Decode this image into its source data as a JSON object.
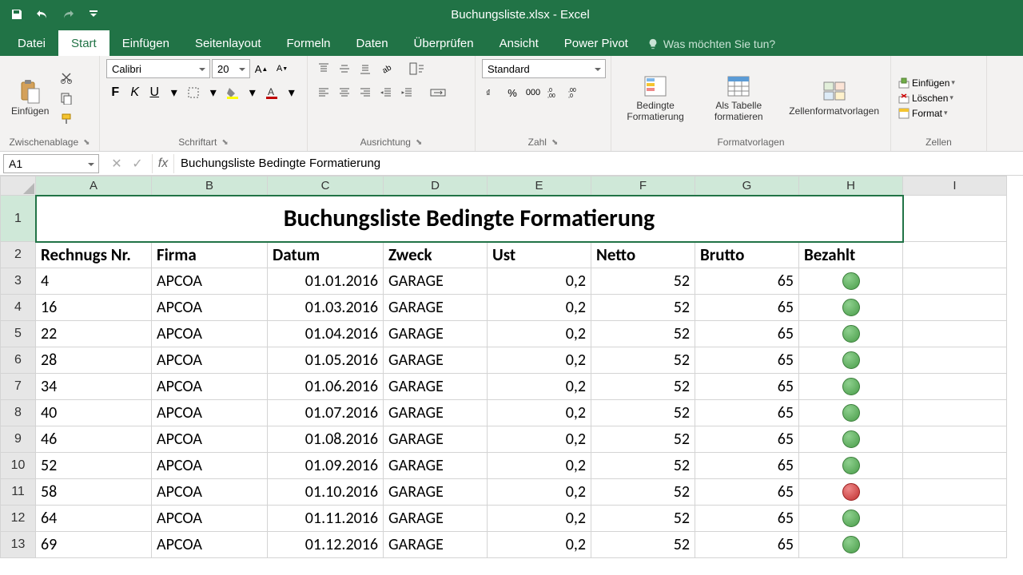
{
  "app": {
    "title": "Buchungsliste.xlsx - Excel"
  },
  "tabs": {
    "file": "Datei",
    "home": "Start",
    "insert": "Einfügen",
    "pagelayout": "Seitenlayout",
    "formulas": "Formeln",
    "data": "Daten",
    "review": "Überprüfen",
    "view": "Ansicht",
    "powerpivot": "Power Pivot",
    "tellme": "Was möchten Sie tun?"
  },
  "ribbon": {
    "clipboard": {
      "label": "Zwischenablage",
      "paste": "Einfügen"
    },
    "font": {
      "label": "Schriftart",
      "name": "Calibri",
      "size": "20",
      "bold": "F",
      "italic": "K",
      "underline": "U"
    },
    "alignment": {
      "label": "Ausrichtung"
    },
    "number": {
      "label": "Zahl",
      "format": "Standard"
    },
    "styles": {
      "label": "Formatvorlagen",
      "cond": "Bedingte Formatierung",
      "table": "Als Tabelle formatieren",
      "cellstyles": "Zellenformatvorlagen"
    },
    "cells": {
      "label": "Zellen",
      "insert": "Einfügen",
      "delete": "Löschen",
      "format": "Format"
    }
  },
  "formula_bar": {
    "name_box": "A1",
    "formula": "Buchungsliste Bedingte Formatierung"
  },
  "columns": [
    "A",
    "B",
    "C",
    "D",
    "E",
    "F",
    "G",
    "H",
    "I"
  ],
  "sheet": {
    "title": "Buchungsliste Bedingte Formatierung",
    "headers": {
      "a": "Rechnugs Nr.",
      "b": "Firma",
      "c": "Datum",
      "d": "Zweck",
      "e": "Ust",
      "f": "Netto",
      "g": "Brutto",
      "h": "Bezahlt"
    },
    "rows": [
      {
        "n": "4",
        "firma": "APCOA",
        "datum": "01.01.2016",
        "zweck": "GARAGE",
        "ust": "0,2",
        "netto": "52",
        "brutto": "65",
        "paid": "green"
      },
      {
        "n": "16",
        "firma": "APCOA",
        "datum": "01.03.2016",
        "zweck": "GARAGE",
        "ust": "0,2",
        "netto": "52",
        "brutto": "65",
        "paid": "green"
      },
      {
        "n": "22",
        "firma": "APCOA",
        "datum": "01.04.2016",
        "zweck": "GARAGE",
        "ust": "0,2",
        "netto": "52",
        "brutto": "65",
        "paid": "green"
      },
      {
        "n": "28",
        "firma": "APCOA",
        "datum": "01.05.2016",
        "zweck": "GARAGE",
        "ust": "0,2",
        "netto": "52",
        "brutto": "65",
        "paid": "green"
      },
      {
        "n": "34",
        "firma": "APCOA",
        "datum": "01.06.2016",
        "zweck": "GARAGE",
        "ust": "0,2",
        "netto": "52",
        "brutto": "65",
        "paid": "green"
      },
      {
        "n": "40",
        "firma": "APCOA",
        "datum": "01.07.2016",
        "zweck": "GARAGE",
        "ust": "0,2",
        "netto": "52",
        "brutto": "65",
        "paid": "green"
      },
      {
        "n": "46",
        "firma": "APCOA",
        "datum": "01.08.2016",
        "zweck": "GARAGE",
        "ust": "0,2",
        "netto": "52",
        "brutto": "65",
        "paid": "green"
      },
      {
        "n": "52",
        "firma": "APCOA",
        "datum": "01.09.2016",
        "zweck": "GARAGE",
        "ust": "0,2",
        "netto": "52",
        "brutto": "65",
        "paid": "green"
      },
      {
        "n": "58",
        "firma": "APCOA",
        "datum": "01.10.2016",
        "zweck": "GARAGE",
        "ust": "0,2",
        "netto": "52",
        "brutto": "65",
        "paid": "red"
      },
      {
        "n": "64",
        "firma": "APCOA",
        "datum": "01.11.2016",
        "zweck": "GARAGE",
        "ust": "0,2",
        "netto": "52",
        "brutto": "65",
        "paid": "green"
      },
      {
        "n": "69",
        "firma": "APCOA",
        "datum": "01.12.2016",
        "zweck": "GARAGE",
        "ust": "0,2",
        "netto": "52",
        "brutto": "65",
        "paid": "green"
      }
    ]
  }
}
